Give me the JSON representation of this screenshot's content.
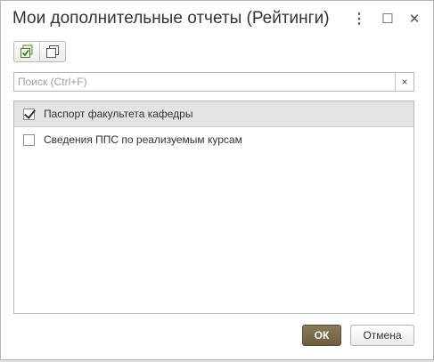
{
  "window": {
    "title": "Мои дополнительные отчеты (Рейтинги)",
    "more_glyph": "⋮",
    "maximize_glyph": "☐",
    "close_glyph": "✕"
  },
  "toolbar": {
    "buttons": [
      {
        "icon": "check-all-icon"
      },
      {
        "icon": "uncheck-all-icon"
      }
    ]
  },
  "search": {
    "placeholder": "Поиск (Ctrl+F)",
    "value": "",
    "clear_glyph": "×"
  },
  "list": {
    "items": [
      {
        "label": "Паспорт факультета кафедры",
        "checked": true,
        "selected": true
      },
      {
        "label": "Сведения ППС по реализуемым курсам",
        "checked": false,
        "selected": false
      }
    ]
  },
  "footer": {
    "ok_label": "ОК",
    "cancel_label": "Отмена"
  },
  "colors": {
    "ok_button": "#7b6a4b",
    "selected_row": "#e4e4e4"
  }
}
